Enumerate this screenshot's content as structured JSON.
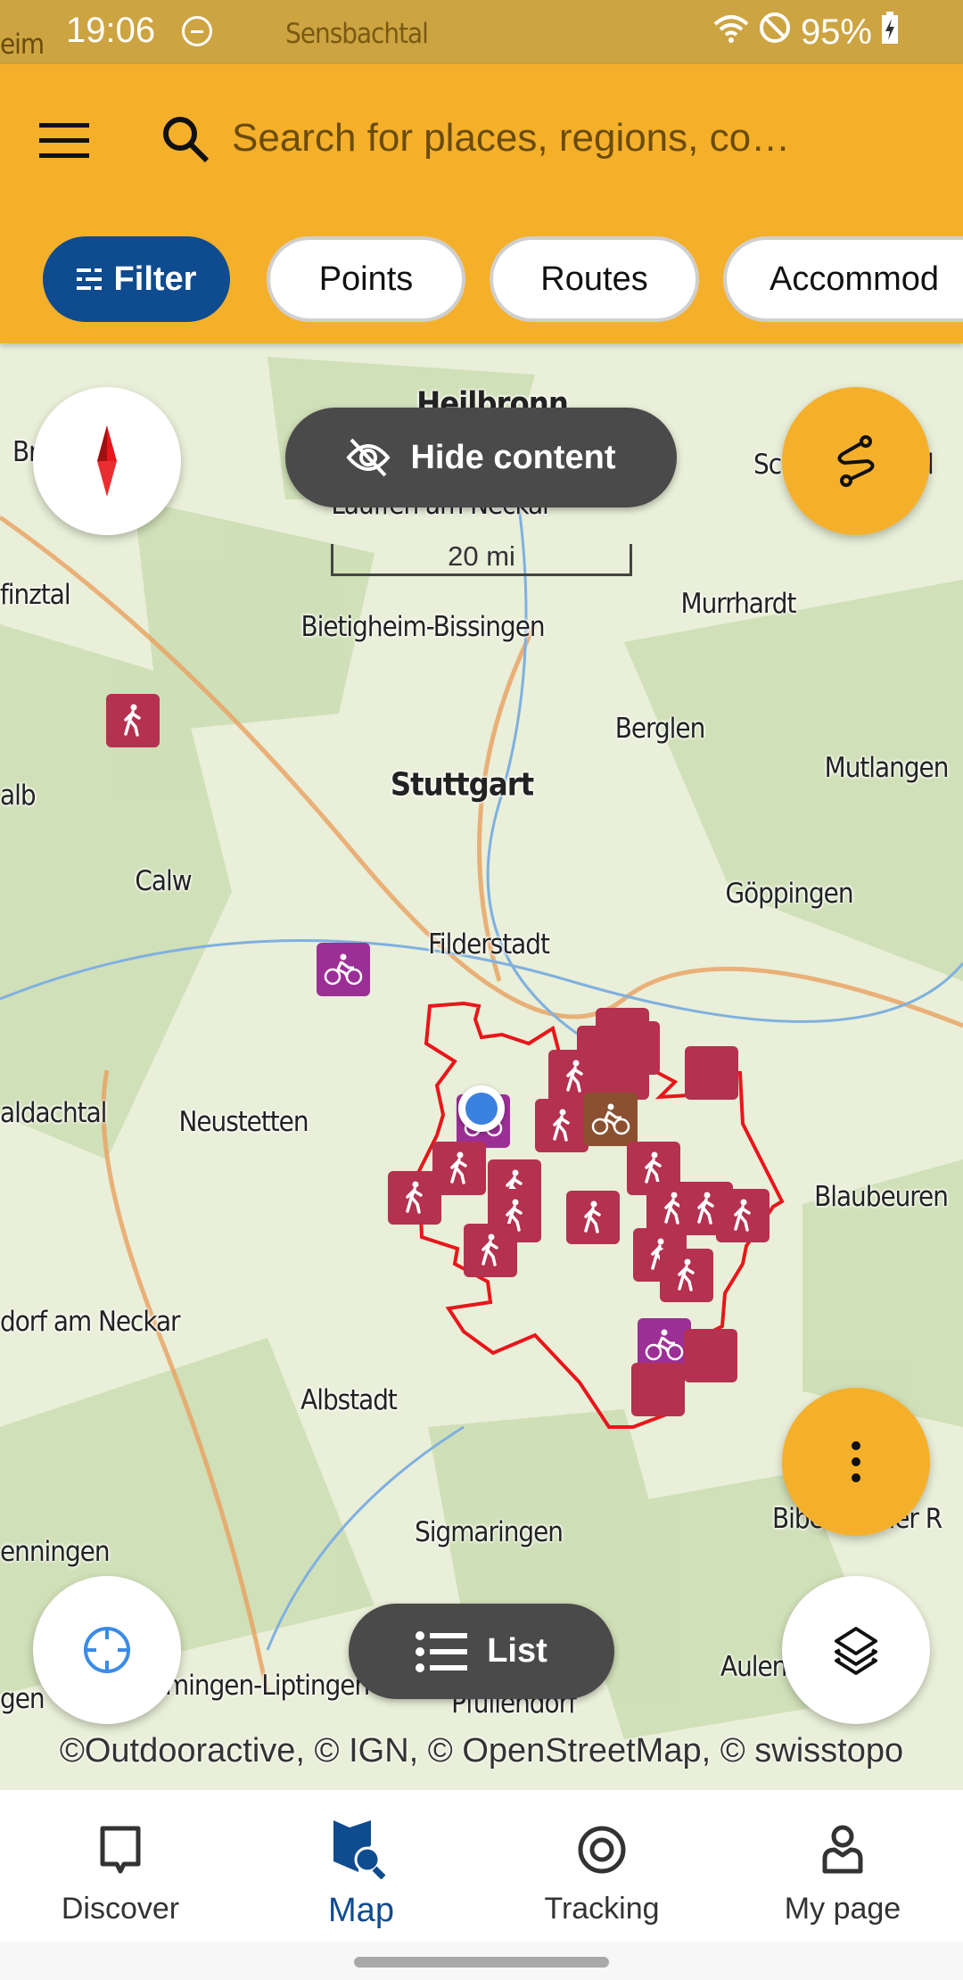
{
  "status_bar": {
    "time": "19:06",
    "battery": "95%",
    "icons": [
      "dnd-icon",
      "wifi-icon",
      "no-disturb-icon",
      "battery-charging-icon"
    ]
  },
  "header": {
    "search_placeholder": "Search for places, regions, co…",
    "chips": [
      {
        "label": "Filter",
        "icon": "sliders-icon",
        "active": true
      },
      {
        "label": "Points"
      },
      {
        "label": "Routes"
      },
      {
        "label": "Accommod"
      }
    ]
  },
  "map": {
    "hide_content_label": "Hide content",
    "scale_label": "20 mi",
    "list_label": "List",
    "attribution": "©Outdooractive, © IGN, © OpenStreetMap, © swisstopo",
    "labels": [
      "Sensbachtal",
      "eim",
      "Heilbronn",
      "Lauffen am Neckar",
      "Br",
      "Sc",
      "l",
      "finztal",
      "Bietigheim-Bissingen",
      "Murrhardt",
      "Berglen",
      "Stuttgart",
      "Mutlangen",
      "alb",
      "Calw",
      "Göppingen",
      "Filderstadt",
      "aldachtal",
      "Neustetten",
      "Blaubeuren",
      "dorf am Neckar",
      "Albstadt",
      "Sigmaringen",
      "Bibe",
      "n der R",
      "enningen",
      "mingen-Liptingen",
      "gen",
      "Pfullendorf",
      "Aulen"
    ],
    "colors": {
      "hiking": "#b43150",
      "cycling": "#9c2f96",
      "mtb": "#8a5030",
      "region_outline": "#e8161b",
      "location": "#3b82e0"
    }
  },
  "nav": {
    "tabs": [
      {
        "label": "Discover",
        "icon": "speech-bubble-icon"
      },
      {
        "label": "Map",
        "icon": "map-search-icon",
        "active": true
      },
      {
        "label": "Tracking",
        "icon": "target-icon"
      },
      {
        "label": "My page",
        "icon": "person-icon"
      }
    ]
  },
  "accent": "#f5b02b",
  "brand": "#0f4b8f"
}
